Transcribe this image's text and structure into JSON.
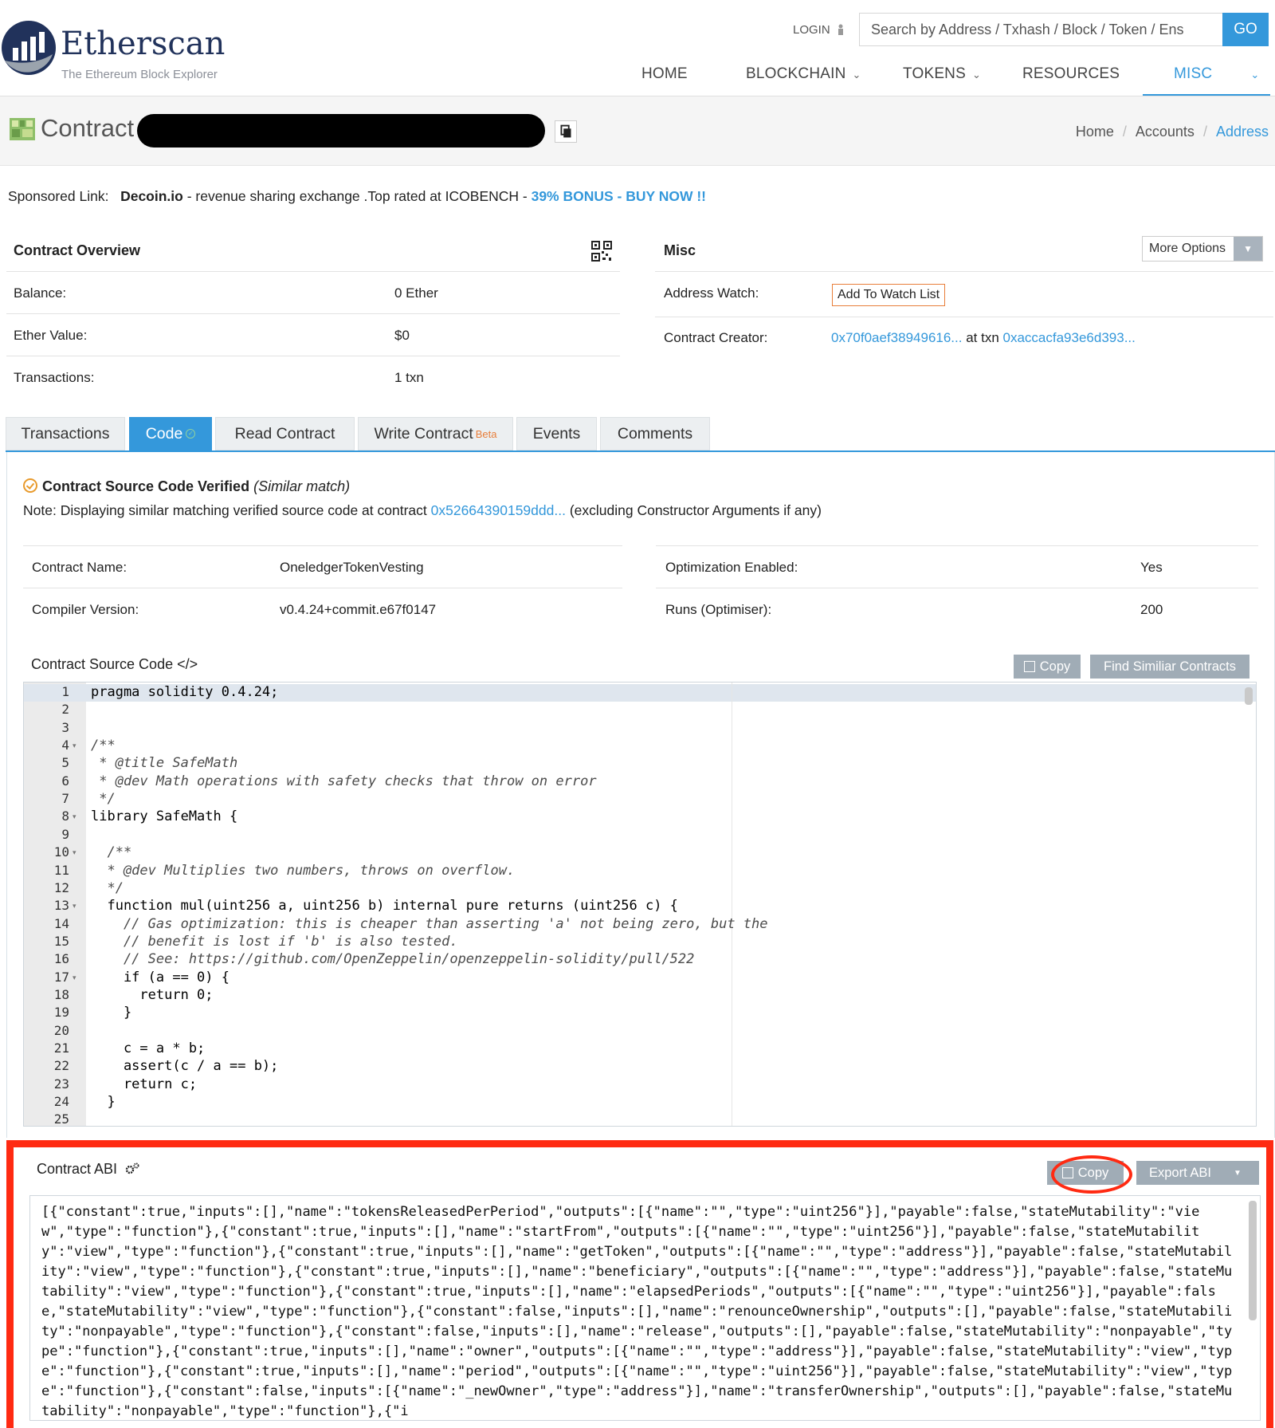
{
  "header": {
    "brand": "Etherscan",
    "tagline": "The Ethereum Block Explorer",
    "login": "LOGIN",
    "search_placeholder": "Search by Address / Txhash / Block / Token / Ens",
    "go": "GO"
  },
  "nav": [
    {
      "label": "HOME",
      "dropdown": false
    },
    {
      "label": "BLOCKCHAIN",
      "dropdown": true
    },
    {
      "label": "TOKENS",
      "dropdown": true
    },
    {
      "label": "RESOURCES",
      "dropdown": false
    },
    {
      "label": "MISC",
      "dropdown": true,
      "active": true
    }
  ],
  "title": {
    "label": "Contract",
    "breadcrumb": [
      "Home",
      "Accounts",
      "Address"
    ]
  },
  "sponsored": {
    "prefix": "Sponsored Link:",
    "brand": "Decoin.io",
    "text": " - revenue sharing exchange .Top rated at ICOBENCH - ",
    "link": "39% BONUS - BUY NOW !!"
  },
  "overview": {
    "title": "Contract Overview",
    "rows": [
      {
        "label": "Balance:",
        "value": "0 Ether"
      },
      {
        "label": "Ether Value:",
        "value": "$0"
      },
      {
        "label": "Transactions:",
        "value": "1 txn"
      }
    ]
  },
  "misc": {
    "title": "Misc",
    "more_options": "More Options",
    "watch_label": "Address Watch:",
    "watch_button": "Add To Watch List",
    "creator_label": "Contract Creator:",
    "creator_address": "0x70f0aef38949616...",
    "creator_at": " at txn ",
    "creator_txn": "0xaccacfa93e6d393..."
  },
  "tabs": [
    {
      "label": "Transactions"
    },
    {
      "label": "Code",
      "active": true
    },
    {
      "label": "Read Contract"
    },
    {
      "label": "Write Contract",
      "badge": "Beta"
    },
    {
      "label": "Events"
    },
    {
      "label": "Comments"
    }
  ],
  "code": {
    "verified_title": "Contract Source Code Verified",
    "verified_match": "(Similar match)",
    "note_prefix": "Note: Displaying similar matching verified source code at contract ",
    "note_link": "0x52664390159ddd...",
    "note_suffix": " (excluding Constructor Arguments if any)",
    "details_left": [
      {
        "label": "Contract Name:",
        "value": "OneledgerTokenVesting"
      },
      {
        "label": "Compiler Version:",
        "value": "v0.4.24+commit.e67f0147"
      }
    ],
    "details_right": [
      {
        "label": "Optimization Enabled:",
        "value": "Yes"
      },
      {
        "label": "Runs (Optimiser):",
        "value": "200"
      }
    ],
    "source_label": "Contract Source Code </>",
    "copy_button": "Copy",
    "find_similar_button": "Find Similiar Contracts",
    "line_numbers": [
      "1",
      "2",
      "3",
      "4",
      "5",
      "6",
      "7",
      "8",
      "9",
      "10",
      "11",
      "12",
      "13",
      "14",
      "15",
      "16",
      "17",
      "18",
      "19",
      "20",
      "21",
      "22",
      "23",
      "24",
      "25"
    ],
    "lines": [
      "pragma solidity 0.4.24;",
      "",
      "",
      "/**",
      " * @title SafeMath",
      " * @dev Math operations with safety checks that throw on error",
      " */",
      "library SafeMath {",
      "",
      "  /**",
      "  * @dev Multiplies two numbers, throws on overflow.",
      "  */",
      "  function mul(uint256 a, uint256 b) internal pure returns (uint256 c) {",
      "    // Gas optimization: this is cheaper than asserting 'a' not being zero, but the",
      "    // benefit is lost if 'b' is also tested.",
      "    // See: https://github.com/OpenZeppelin/openzeppelin-solidity/pull/522",
      "    if (a == 0) {",
      "      return 0;",
      "    }",
      "",
      "    c = a * b;",
      "    assert(c / a == b);",
      "    return c;",
      "  }",
      ""
    ]
  },
  "abi": {
    "label": "Contract ABI",
    "copy_button": "Copy",
    "export_button": "Export ABI",
    "text": "[{\"constant\":true,\"inputs\":[],\"name\":\"tokensReleasedPerPeriod\",\"outputs\":[{\"name\":\"\",\"type\":\"uint256\"}],\"payable\":false,\"stateMutability\":\"view\",\"type\":\"function\"},{\"constant\":true,\"inputs\":[],\"name\":\"startFrom\",\"outputs\":[{\"name\":\"\",\"type\":\"uint256\"}],\"payable\":false,\"stateMutability\":\"view\",\"type\":\"function\"},{\"constant\":true,\"inputs\":[],\"name\":\"getToken\",\"outputs\":[{\"name\":\"\",\"type\":\"address\"}],\"payable\":false,\"stateMutability\":\"view\",\"type\":\"function\"},{\"constant\":true,\"inputs\":[],\"name\":\"beneficiary\",\"outputs\":[{\"name\":\"\",\"type\":\"address\"}],\"payable\":false,\"stateMutability\":\"view\",\"type\":\"function\"},{\"constant\":true,\"inputs\":[],\"name\":\"elapsedPeriods\",\"outputs\":[{\"name\":\"\",\"type\":\"uint256\"}],\"payable\":false,\"stateMutability\":\"view\",\"type\":\"function\"},{\"constant\":false,\"inputs\":[],\"name\":\"renounceOwnership\",\"outputs\":[],\"payable\":false,\"stateMutability\":\"nonpayable\",\"type\":\"function\"},{\"constant\":false,\"inputs\":[],\"name\":\"release\",\"outputs\":[],\"payable\":false,\"stateMutability\":\"nonpayable\",\"type\":\"function\"},{\"constant\":true,\"inputs\":[],\"name\":\"owner\",\"outputs\":[{\"name\":\"\",\"type\":\"address\"}],\"payable\":false,\"stateMutability\":\"view\",\"type\":\"function\"},{\"constant\":true,\"inputs\":[],\"name\":\"period\",\"outputs\":[{\"name\":\"\",\"type\":\"uint256\"}],\"payable\":false,\"stateMutability\":\"view\",\"type\":\"function\"},{\"constant\":false,\"inputs\":[{\"name\":\"_newOwner\",\"type\":\"address\"}],\"name\":\"transferOwnership\",\"outputs\":[],\"payable\":false,\"stateMutability\":\"nonpayable\",\"type\":\"function\"},{\"i"
  },
  "colors": {
    "accent": "#3498db",
    "highlight": "#ff2a12",
    "orange": "#e87e3a"
  },
  "icons": [
    "user-icon",
    "copy-icon",
    "qr-code-icon",
    "contract-icon",
    "check-circle-icon",
    "gear-icon",
    "chevron-down-icon"
  ]
}
